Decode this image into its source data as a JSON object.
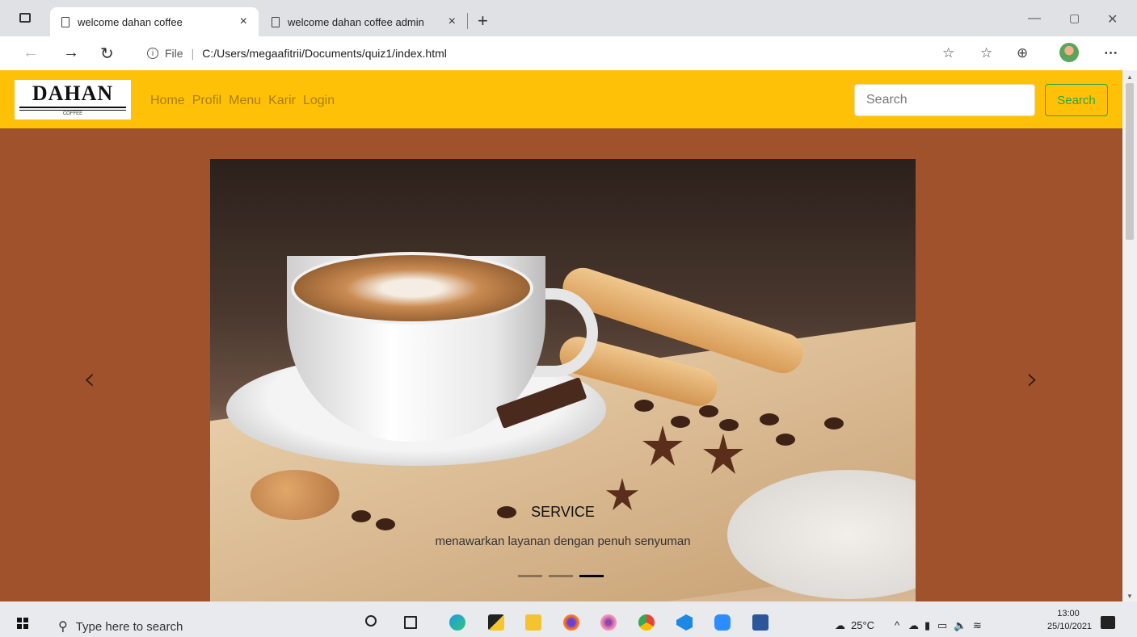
{
  "browser": {
    "tabs": [
      {
        "title": "welcome dahan coffee",
        "active": true
      },
      {
        "title": "welcome dahan coffee admin",
        "active": false
      }
    ],
    "close_glyph": "×",
    "new_tab_glyph": "+",
    "address": {
      "file_label": "File",
      "separator": "|",
      "url": "C:/Users/megaafitrii/Documents/quiz1/index.html"
    }
  },
  "site": {
    "logo": {
      "name": "DAHAN",
      "sub": "COFFEE"
    },
    "nav": [
      "Home",
      "Profil",
      "Menu",
      "Karir",
      "Login"
    ],
    "search": {
      "placeholder": "Search",
      "button_label": "Search"
    },
    "colors": {
      "navbar": "#ffc107",
      "page_bg": "#a0522d",
      "search_button": "#28a745"
    }
  },
  "carousel": {
    "caption_title": "SERVICE",
    "caption_text": "menawarkan layanan dengan penuh senyuman",
    "indicators": 3,
    "active_index": 2,
    "prev_glyph": "‹",
    "next_glyph": "›"
  },
  "taskbar": {
    "search_placeholder": "Type here to search",
    "weather": "25°C",
    "time": "13:00",
    "date": "25/10/2021"
  }
}
